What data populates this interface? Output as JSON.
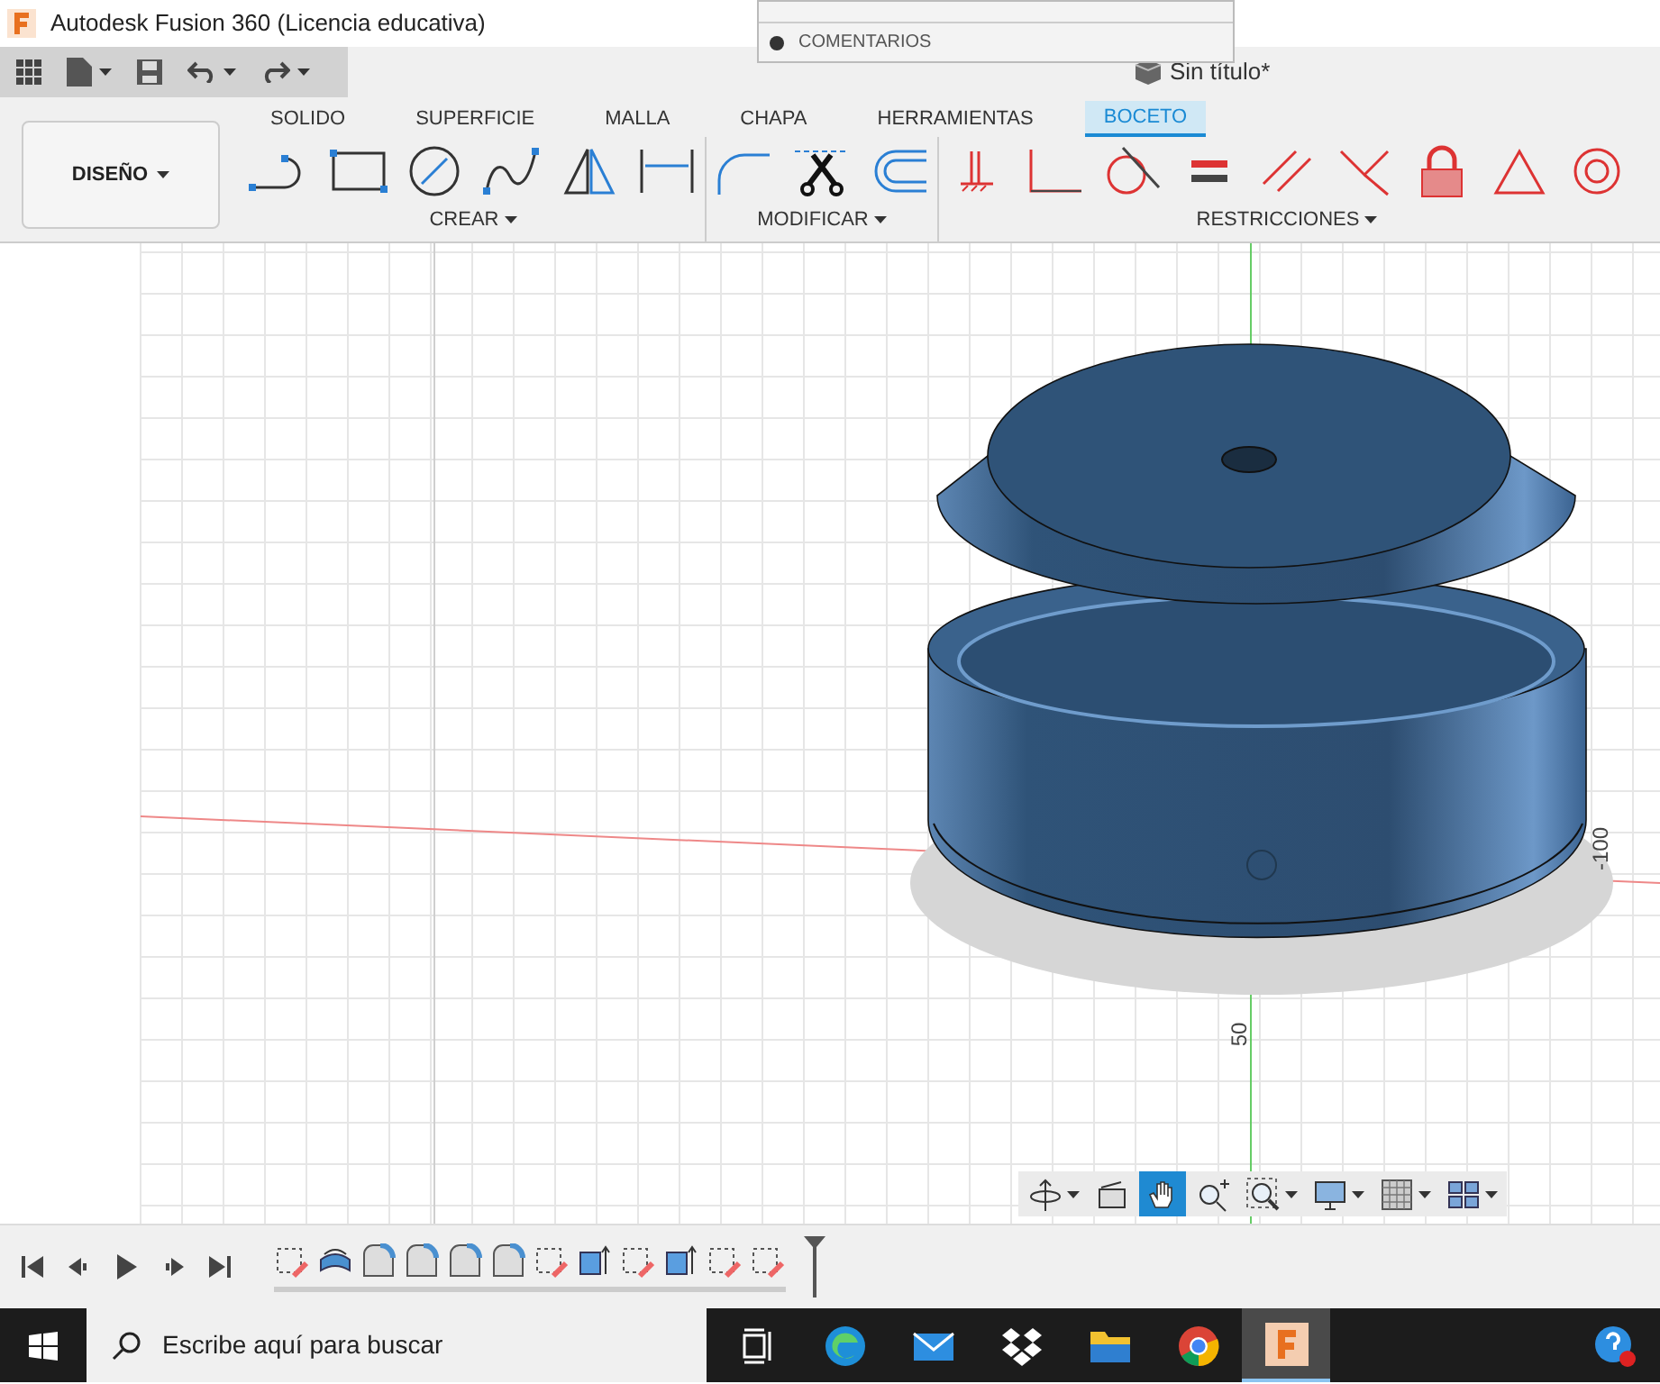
{
  "window": {
    "title": "Autodesk Fusion 360 (Licencia educativa)"
  },
  "browser_menu": {
    "items": [
      {
        "label": "COMENTARIOS"
      }
    ]
  },
  "document": {
    "title": "Sin título*"
  },
  "tabs": [
    {
      "label": "SOLIDO",
      "selected": false
    },
    {
      "label": "SUPERFICIE",
      "selected": false
    },
    {
      "label": "MALLA",
      "selected": false
    },
    {
      "label": "CHAPA",
      "selected": false
    },
    {
      "label": "HERRAMIENTAS",
      "selected": false
    },
    {
      "label": "BOCETO",
      "selected": true
    }
  ],
  "workspace_button": {
    "label": "DISEÑO"
  },
  "tool_groups": [
    {
      "label": "CREAR",
      "tools": [
        {
          "kind": "line"
        },
        {
          "kind": "rectangle"
        },
        {
          "kind": "circle"
        },
        {
          "kind": "spline"
        },
        {
          "kind": "polygon"
        },
        {
          "kind": "dimension"
        }
      ]
    },
    {
      "label": "MODIFICAR",
      "tools": [
        {
          "kind": "fillet"
        },
        {
          "kind": "trim"
        },
        {
          "kind": "offset"
        }
      ]
    },
    {
      "label": "RESTRICCIONES",
      "tools": [
        {
          "kind": "fix"
        },
        {
          "kind": "coincident"
        },
        {
          "kind": "tangent"
        },
        {
          "kind": "equal"
        },
        {
          "kind": "parallel"
        },
        {
          "kind": "perpendicular"
        },
        {
          "kind": "lock"
        },
        {
          "kind": "triangle"
        },
        {
          "kind": "concentric"
        }
      ]
    }
  ],
  "viewport": {
    "axis_labels": [
      "-100",
      "50"
    ]
  },
  "nav_tools": [
    {
      "kind": "orbit",
      "selected": false
    },
    {
      "kind": "look",
      "selected": false
    },
    {
      "kind": "pan",
      "selected": true
    },
    {
      "kind": "zoom",
      "selected": false
    },
    {
      "kind": "fit",
      "selected": false
    },
    {
      "kind": "display",
      "selected": false
    },
    {
      "kind": "grid",
      "selected": false
    },
    {
      "kind": "viewports",
      "selected": false
    }
  ],
  "timeline": {
    "features": [
      {
        "kind": "sketch"
      },
      {
        "kind": "revolve"
      },
      {
        "kind": "fillet"
      },
      {
        "kind": "fillet"
      },
      {
        "kind": "fillet"
      },
      {
        "kind": "fillet"
      },
      {
        "kind": "sketch"
      },
      {
        "kind": "extrude"
      },
      {
        "kind": "sketch"
      },
      {
        "kind": "extrude"
      },
      {
        "kind": "sketch"
      },
      {
        "kind": "sketch"
      }
    ]
  },
  "taskbar": {
    "search_placeholder": "Escribe aquí para buscar",
    "apps": [
      {
        "kind": "taskview",
        "selected": false
      },
      {
        "kind": "edge",
        "selected": false
      },
      {
        "kind": "mail",
        "selected": false
      },
      {
        "kind": "dropbox",
        "selected": false
      },
      {
        "kind": "folder",
        "selected": false
      },
      {
        "kind": "chrome",
        "selected": false
      },
      {
        "kind": "fusion",
        "selected": true
      }
    ]
  }
}
